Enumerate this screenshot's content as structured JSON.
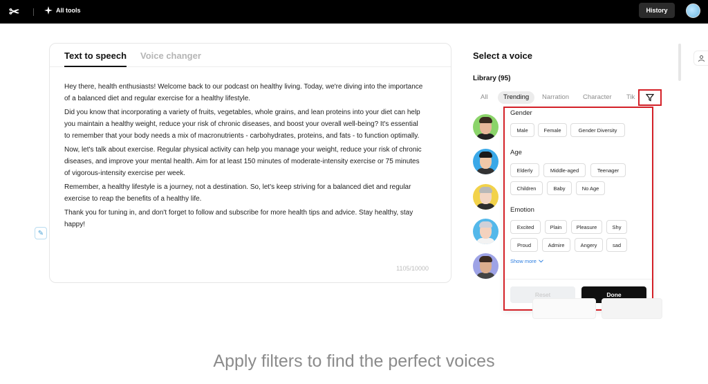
{
  "topbar": {
    "logo": "✂",
    "all_tools": "All tools",
    "history": "History"
  },
  "editor": {
    "tabs": [
      "Text to speech",
      "Voice changer"
    ],
    "paragraphs": [
      "Hey there, health enthusiasts! Welcome back to our podcast on healthy living. Today, we're diving into the importance of a balanced diet and regular exercise for a healthy lifestyle.",
      "Did you know that incorporating a variety of fruits, vegetables, whole grains, and lean proteins into your diet can help you maintain a healthy weight, reduce your risk of chronic diseases, and boost your overall well-being? It's essential to remember that your body needs a mix of macronutrients - carbohydrates, proteins, and fats - to function optimally.",
      "Now, let's talk about exercise. Regular physical activity can help you manage your weight, reduce your risk of chronic diseases, and improve your mental health. Aim for at least 150 minutes of moderate-intensity exercise or 75 minutes of vigorous-intensity exercise per week.",
      "Remember, a healthy lifestyle is a journey, not a destination. So, let's keep striving for a balanced diet and regular exercise to reap the benefits of a healthy life.",
      "Thank you for tuning in, and don't forget to follow and subscribe for more health tips and advice. Stay healthy, stay happy!"
    ],
    "counter": "1105/10000"
  },
  "voice_panel": {
    "title": "Select a voice",
    "library": "Library (95)",
    "categories": [
      "All",
      "Trending",
      "Narration",
      "Character",
      "Tik"
    ]
  },
  "filters": {
    "gender": {
      "title": "Gender",
      "options": [
        "Male",
        "Female",
        "Gender Diversity"
      ]
    },
    "age": {
      "title": "Age",
      "options": [
        "Elderly",
        "Middle-aged",
        "Teenager",
        "Children",
        "Baby",
        "No Age"
      ]
    },
    "emotion": {
      "title": "Emotion",
      "options": [
        "Excited",
        "Plain",
        "Pleasure",
        "Shy",
        "Proud",
        "Admire",
        "Angery",
        "sad"
      ]
    },
    "show_more": "Show more",
    "reset": "Reset",
    "done": "Done"
  },
  "caption": "Apply filters to find the perfect voices",
  "colors": {
    "accent_red": "#d42027",
    "link_blue": "#2b7de0"
  }
}
